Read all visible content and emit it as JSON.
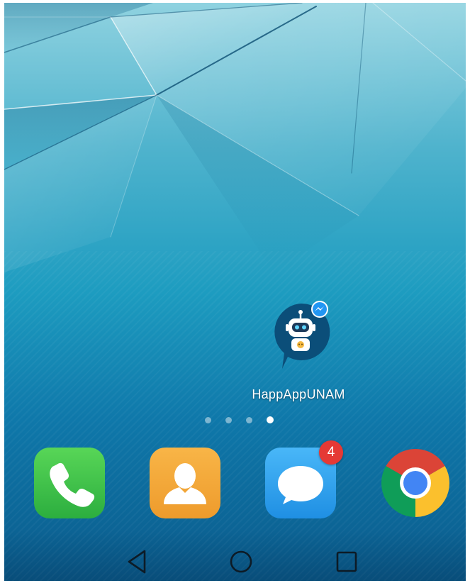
{
  "home": {
    "app_label": "HappAppUNAM",
    "app_icon": "robot-messenger-icon"
  },
  "page_indicator": {
    "total": 4,
    "active_index": 3
  },
  "dock": {
    "phone_icon": "phone-icon",
    "contacts_icon": "contacts-icon",
    "messages_icon": "messages-icon",
    "messages_badge": "4",
    "chrome_icon": "chrome-icon"
  },
  "navigation": {
    "back": "back-icon",
    "home": "home-icon",
    "recents": "recents-icon"
  },
  "colors": {
    "badge": "#e53935",
    "phone": "#2cae3f",
    "contacts": "#ee9b2c",
    "messages": "#1f8fe3",
    "messenger_blue": "#2196f3"
  }
}
